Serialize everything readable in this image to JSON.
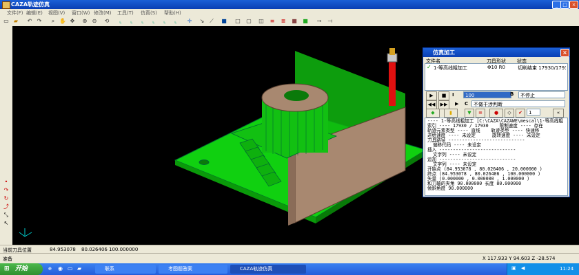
{
  "window": {
    "title": "CAZA轨迹仿真",
    "min": "_",
    "max": "□",
    "close": "×"
  },
  "menu": [
    "文件(F)",
    "编辑(E)",
    "视图(V)",
    "窗口(W)",
    "修改(M)",
    "工具(T)",
    "仿真(S)",
    "帮助(H)"
  ],
  "dialog": {
    "title": "仿真加工",
    "headers": {
      "file": "文件名",
      "tool": "刀具形状",
      "state": "状态"
    },
    "file_row": {
      "name": "1-等高线粗加工",
      "tool": "Φ10 R0",
      "state": "切削结束 17930/17930"
    },
    "row1": {
      "speed": "100",
      "speed_label": "I",
      "b_label": "B",
      "b_option": "不停止"
    },
    "row2": {
      "c_label": "C",
      "c_option": "不做干涉判断"
    },
    "counter": "1",
    "info_lines": [
      "---- 1-等高线粗加工 [C:\\CAZA\\CAZAWE\\mescal\\1-等高线粗",
      "索引 ---- 17930 / 17930    限制速度 ---- 存在",
      "轨迹元素类型 ---- 直线    轨迹类型 ---- 快速移",
      "进给速度 ---- 未设定      旋转速度 ---- 未设定",
      "刀具路径 ----------------------------",
      "  偏移代码 ---- 未设定",
      "插入 ----------------------------",
      "  文字列 ---- 未设定",
      "追加 ----------------------------",
      "  文字列 ---- 未设定",
      "开始点 (84.953078 , 80.026406 , 20.000000 )",
      "终点 (84.953078 , 80.026406 , 100.000000 )",
      "矢量 (0.000000 , 0.000000 , 1.000000 )",
      "和刀轴的夹角 90.000000 长度 80.000000",
      "倾斜角度 90.000000"
    ]
  },
  "status": {
    "label": "当前刀具位置",
    "x": "84.953078",
    "y": "80.026406",
    "z": "100.000000",
    "ready": "准备",
    "coords": "X 117.933 Y 94.603 Z -28.574"
  },
  "taskbar": {
    "start": "开始",
    "tasks": [
      "联系",
      "考图题答案",
      "CAZA轨迹仿真"
    ],
    "clock": "11:24"
  },
  "colors": {
    "model_green": "#10d010",
    "stock_brown": "#a88870",
    "tool_red": "#e01010"
  }
}
